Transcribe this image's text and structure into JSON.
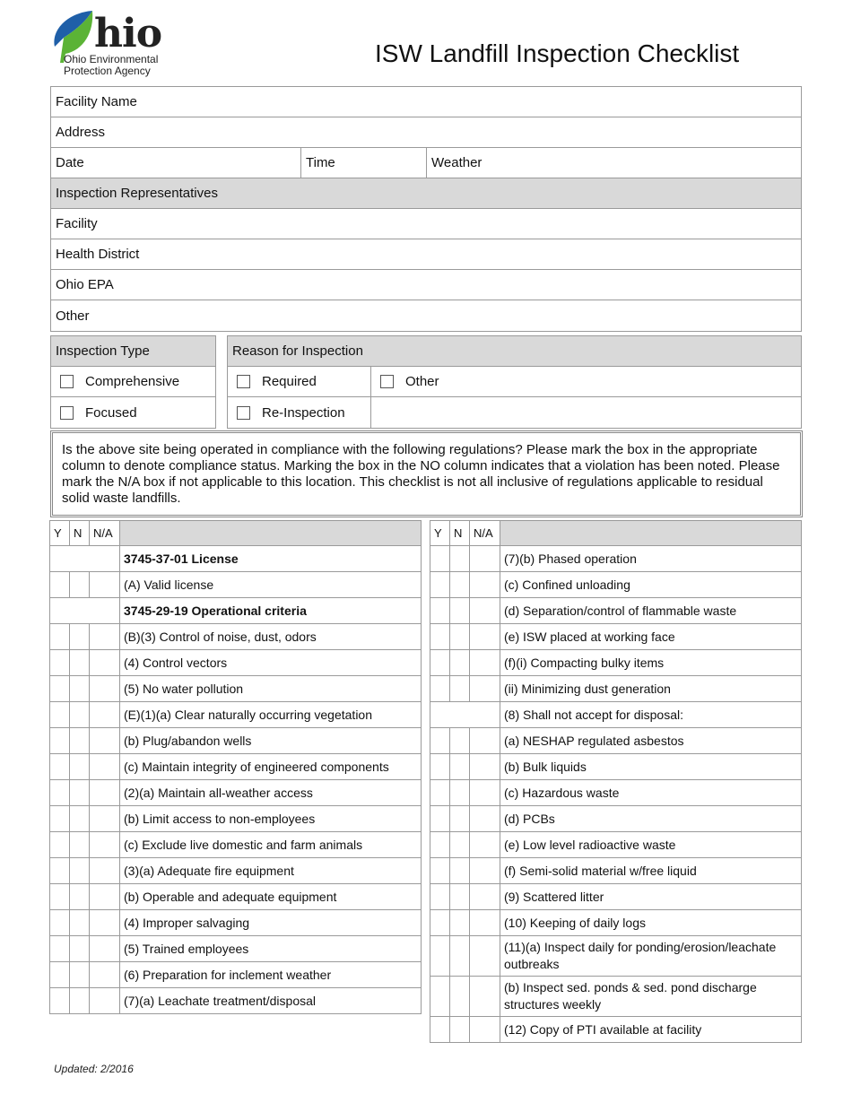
{
  "header": {
    "logo_word": "hio",
    "logo_agency_line1": "Ohio Environmental",
    "logo_agency_line2": "Protection Agency",
    "title": "ISW Landfill Inspection Checklist"
  },
  "form": {
    "facility_name": "Facility Name",
    "address": "Address",
    "date": "Date",
    "time": "Time",
    "weather": "Weather",
    "representatives_header": "Inspection Representatives",
    "representatives": [
      "Facility",
      "Health District",
      "Ohio EPA",
      "Other"
    ]
  },
  "inspection_type": {
    "header": "Inspection Type",
    "options": [
      "Comprehensive",
      "Focused"
    ]
  },
  "reason": {
    "header": "Reason for Inspection",
    "options": [
      "Required",
      "Other",
      "Re-Inspection"
    ]
  },
  "notice": "Is the above site being operated  in compliance with the following regulations?  Please mark the box in the appropriate column to denote compliance status.  Marking the box in the NO column indicates that a violation has been noted.  Please mark the N/A box if not applicable to this location.  This checklist is not all inclusive of regulations applicable to residual solid waste landfills.",
  "columns": {
    "y": "Y",
    "n": "N",
    "na": "N/A"
  },
  "left_items": [
    {
      "text": "3745-37-01 License",
      "section": true
    },
    {
      "text": "(A) Valid license"
    },
    {
      "text": "3745-29-19 Operational criteria",
      "section": true
    },
    {
      "text": "(B)(3) Control of noise, dust, odors"
    },
    {
      "text": "(4) Control vectors"
    },
    {
      "text": "(5) No water pollution"
    },
    {
      "text": "(E)(1)(a) Clear naturally occurring vegetation"
    },
    {
      "text": "(b) Plug/abandon wells"
    },
    {
      "text": "(c) Maintain integrity of engineered components"
    },
    {
      "text": "(2)(a) Maintain all-weather access"
    },
    {
      "text": "(b) Limit access to non-employees"
    },
    {
      "text": "(c) Exclude live domestic and farm animals"
    },
    {
      "text": "(3)(a) Adequate fire equipment"
    },
    {
      "text": "(b) Operable and adequate equipment"
    },
    {
      "text": "(4) Improper salvaging"
    },
    {
      "text": "(5) Trained employees"
    },
    {
      "text": "(6) Preparation for inclement weather"
    },
    {
      "text": "(7)(a) Leachate treatment/disposal"
    }
  ],
  "right_items": [
    {
      "text": "(7)(b) Phased operation"
    },
    {
      "text": "(c) Confined unloading"
    },
    {
      "text": "(d) Separation/control of flammable waste"
    },
    {
      "text": "(e) ISW placed at working face"
    },
    {
      "text": "(f)(i) Compacting bulky items"
    },
    {
      "text": "(ii) Minimizing dust generation"
    },
    {
      "text": "(8) Shall not accept for disposal:",
      "section": true,
      "plain": true
    },
    {
      "text": "(a) NESHAP regulated asbestos"
    },
    {
      "text": "(b) Bulk liquids"
    },
    {
      "text": "(c) Hazardous waste"
    },
    {
      "text": "(d) PCBs"
    },
    {
      "text": "(e) Low level radioactive waste"
    },
    {
      "text": "(f) Semi-solid material w/free liquid"
    },
    {
      "text": "(9) Scattered litter"
    },
    {
      "text": "(10) Keeping of daily logs"
    },
    {
      "text": "(11)(a) Inspect daily for ponding/erosion/leachate outbreaks",
      "tall": true
    },
    {
      "text": "(b) Inspect sed. ponds & sed. pond discharge structures weekly",
      "tall": true
    },
    {
      "text": "(12) Copy of PTI available at facility"
    }
  ],
  "footer": "Updated: 2/2016",
  "colors": {
    "leaf_blue": "#1f5fa8",
    "leaf_green": "#5bb336",
    "shade": "#d9d9d9",
    "border": "#9a9a9a"
  }
}
